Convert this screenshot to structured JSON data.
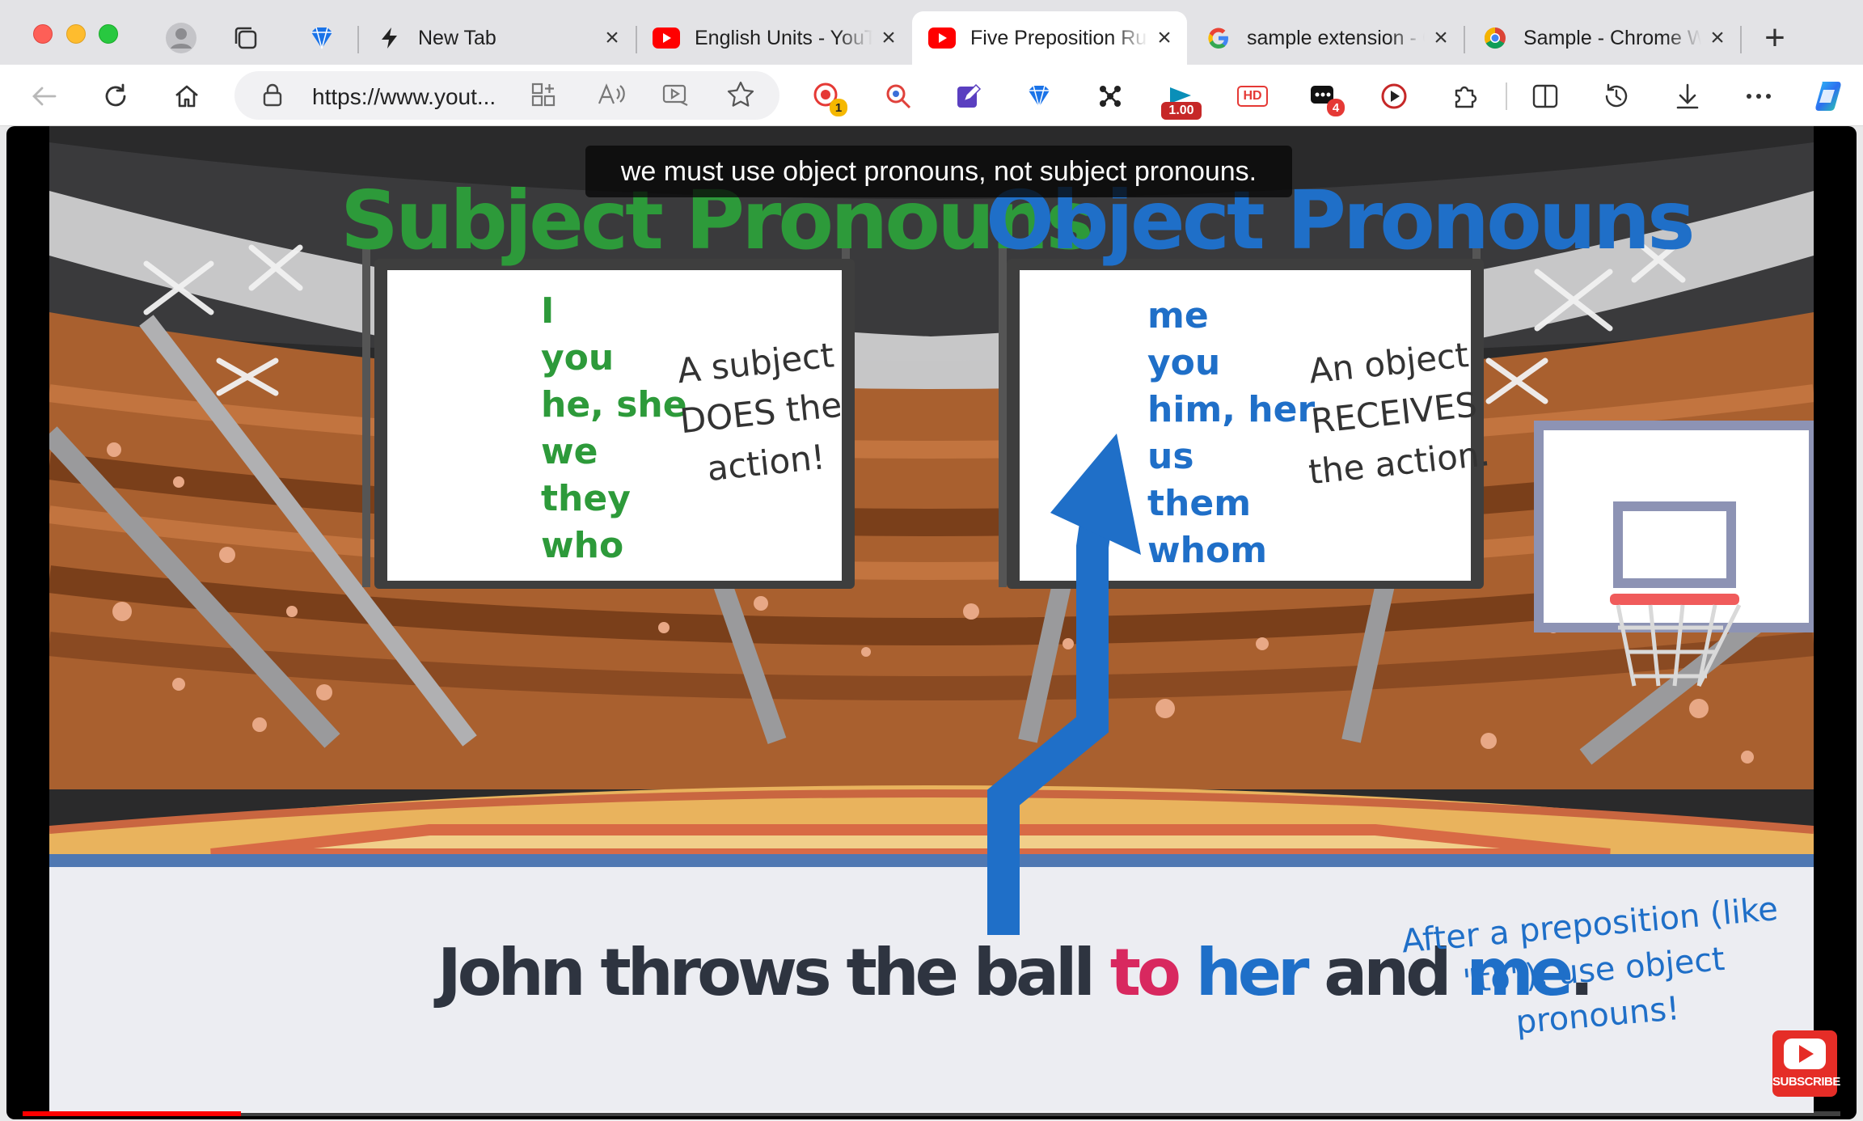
{
  "window": {
    "controls": [
      "close",
      "minimize",
      "zoom"
    ]
  },
  "tabs": [
    {
      "title": "New Tab",
      "icon": "lightning-icon",
      "active": false
    },
    {
      "title": "English Units - YouTube",
      "icon": "youtube-icon",
      "active": false
    },
    {
      "title": "Five Preposition Rules",
      "icon": "youtube-icon",
      "active": true
    },
    {
      "title": "sample extension - Google Search",
      "icon": "google-icon",
      "active": false
    },
    {
      "title": "Sample - Chrome Web Store",
      "icon": "chrome-icon",
      "active": false
    }
  ],
  "toolbar": {
    "url": "https://www.yout...",
    "extensions": [
      {
        "name": "screen-recorder-icon",
        "badge": "1"
      },
      {
        "name": "zoom-search-icon"
      },
      {
        "name": "note-edit-icon"
      },
      {
        "name": "diamond-extension-icon"
      },
      {
        "name": "connect-nodes-icon"
      },
      {
        "name": "playback-speed-icon",
        "badge": "1.00"
      },
      {
        "name": "hd-quality-icon",
        "label": "HD"
      },
      {
        "name": "messages-icon",
        "badge": "4"
      },
      {
        "name": "video-capture-icon"
      },
      {
        "name": "puzzle-extensions-icon"
      }
    ]
  },
  "video": {
    "caption": "we must use object pronouns, not subject pronouns.",
    "progress_fraction": 0.12,
    "subscribe_label": "SUBSCRIBE",
    "scene": {
      "subject_title": "Subject Pronouns",
      "object_title": "Object Pronouns",
      "subject_pronouns": [
        "I",
        "you",
        "he, she",
        "we",
        "they",
        "who"
      ],
      "subject_note": [
        "A subject",
        "DOES the",
        "action!"
      ],
      "object_pronouns": [
        "me",
        "you",
        "him, her",
        "us",
        "them",
        "whom"
      ],
      "object_note": [
        "An object",
        "RECEIVES",
        "the action."
      ],
      "sentence": {
        "part1": "John throws the ball ",
        "prep": "to",
        "space1": " ",
        "obj1": "her",
        "part2": " and ",
        "obj2": "me",
        "end": "."
      },
      "tip_line1": "After a preposition (like",
      "tip_line2": "\"to\"), use object pronouns!"
    },
    "colors": {
      "subject_green": "#2d9a3a",
      "object_blue": "#1f6fc8",
      "preposition_pink": "#d8285f"
    }
  }
}
